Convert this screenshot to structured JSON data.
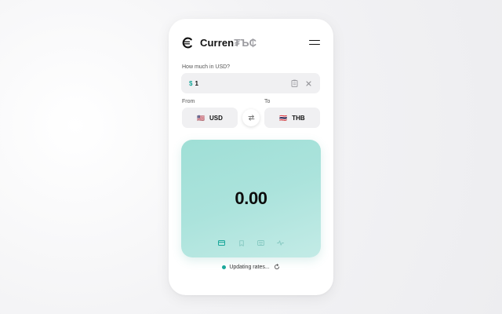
{
  "app": {
    "name": "Curren",
    "name_symbols": "₮Ъ₵"
  },
  "amount": {
    "label": "How much in USD?",
    "currency_symbol": "$",
    "value": "1"
  },
  "from": {
    "label": "From",
    "flag": "🇺🇸",
    "code": "USD"
  },
  "to": {
    "label": "To",
    "flag": "🇹🇭",
    "code": "THB"
  },
  "result": {
    "value": "0.00"
  },
  "status": {
    "text": "Updating rates..."
  },
  "colors": {
    "accent": "#1aa79a",
    "panel": "#abe3dc"
  },
  "icons": [
    "currency-logo-icon",
    "menu-icon",
    "clipboard-icon",
    "clear-icon",
    "swap-icon",
    "card-icon",
    "bookmark-icon",
    "keyboard-icon",
    "activity-icon",
    "refresh-icon"
  ]
}
